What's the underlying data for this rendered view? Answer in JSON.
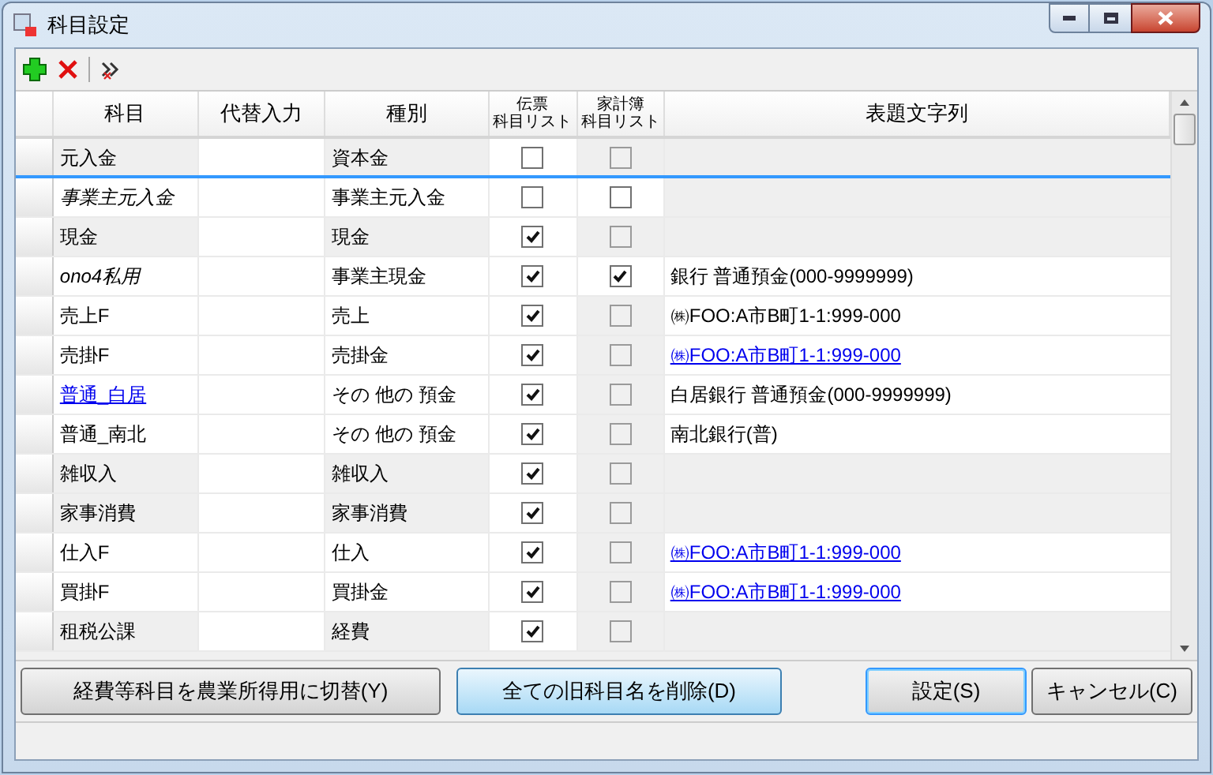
{
  "window": {
    "title": "科目設定"
  },
  "table": {
    "columns": [
      [
        "科目"
      ],
      [
        "代替入力"
      ],
      [
        "種別"
      ],
      [
        "伝票",
        "科目リスト"
      ],
      [
        "家計簿",
        "科目リスト"
      ],
      [
        "表題文字列"
      ]
    ],
    "rows": [
      {
        "name": "元入金",
        "alt": "",
        "type": "資本金",
        "denpyo": false,
        "kakeibo": false,
        "kakeibo_disabled": true,
        "title": "",
        "shaded": true,
        "italic": false,
        "link": false,
        "selected": true
      },
      {
        "name": "事業主元入金",
        "alt": "",
        "type": "事業主元入金",
        "denpyo": false,
        "kakeibo": false,
        "kakeibo_disabled": false,
        "title": "",
        "shaded": false,
        "italic": true,
        "link": false,
        "selected": false
      },
      {
        "name": "現金",
        "alt": "",
        "type": "現金",
        "denpyo": true,
        "kakeibo": false,
        "kakeibo_disabled": true,
        "title": "",
        "shaded": true,
        "italic": false,
        "link": false,
        "selected": false
      },
      {
        "name": "ono4私用",
        "alt": "",
        "type": "事業主現金",
        "denpyo": true,
        "kakeibo": true,
        "kakeibo_disabled": false,
        "title": "銀行 普通預金(000-9999999)",
        "shaded": false,
        "italic": true,
        "link": false,
        "title_link": false,
        "selected": false
      },
      {
        "name": "売上F",
        "alt": "",
        "type": "売上",
        "denpyo": true,
        "kakeibo": false,
        "kakeibo_disabled": true,
        "title": "㈱FOO:A市B町1-1:999-000",
        "shaded": false,
        "italic": false,
        "link": false,
        "title_link": false,
        "selected": false
      },
      {
        "name": "売掛F",
        "alt": "",
        "type": "売掛金",
        "denpyo": true,
        "kakeibo": false,
        "kakeibo_disabled": true,
        "title": "㈱FOO:A市B町1-1:999-000",
        "shaded": false,
        "italic": false,
        "link": false,
        "title_link": true,
        "selected": false
      },
      {
        "name": "普通_白居",
        "alt": "",
        "type": "その 他の 預金",
        "denpyo": true,
        "kakeibo": false,
        "kakeibo_disabled": true,
        "title": "白居銀行 普通預金(000-9999999)",
        "shaded": false,
        "italic": false,
        "link": true,
        "title_link": false,
        "selected": false
      },
      {
        "name": "普通_南北",
        "alt": "",
        "type": "その 他の 預金",
        "denpyo": true,
        "kakeibo": false,
        "kakeibo_disabled": true,
        "title": "南北銀行(普)",
        "shaded": false,
        "italic": false,
        "link": false,
        "title_link": false,
        "selected": false
      },
      {
        "name": "雑収入",
        "alt": "",
        "type": "雑収入",
        "denpyo": true,
        "kakeibo": false,
        "kakeibo_disabled": true,
        "title": "",
        "shaded": true,
        "italic": false,
        "link": false,
        "selected": false
      },
      {
        "name": "家事消費",
        "alt": "",
        "type": "家事消費",
        "denpyo": true,
        "kakeibo": false,
        "kakeibo_disabled": true,
        "title": "",
        "shaded": true,
        "italic": false,
        "link": false,
        "selected": false
      },
      {
        "name": "仕入F",
        "alt": "",
        "type": "仕入",
        "denpyo": true,
        "kakeibo": false,
        "kakeibo_disabled": true,
        "title": "㈱FOO:A市B町1-1:999-000",
        "shaded": false,
        "italic": false,
        "link": false,
        "title_link": true,
        "selected": false
      },
      {
        "name": "買掛F",
        "alt": "",
        "type": "買掛金",
        "denpyo": true,
        "kakeibo": false,
        "kakeibo_disabled": true,
        "title": "㈱FOO:A市B町1-1:999-000",
        "shaded": false,
        "italic": false,
        "link": false,
        "title_link": true,
        "selected": false
      },
      {
        "name": "租税公課",
        "alt": "",
        "type": "経費",
        "denpyo": true,
        "kakeibo": false,
        "kakeibo_disabled": true,
        "title": "",
        "shaded": true,
        "italic": false,
        "link": false,
        "selected": false
      }
    ]
  },
  "buttons": [
    {
      "label": "経費等科目を農業所得用に切替(Y)",
      "hover": false
    },
    {
      "label": "全ての旧科目名を削除(D)",
      "hover": true
    },
    {
      "label": "設定(S)",
      "hover": false,
      "default": true
    },
    {
      "label": "キャンセル(C)",
      "hover": false
    }
  ]
}
